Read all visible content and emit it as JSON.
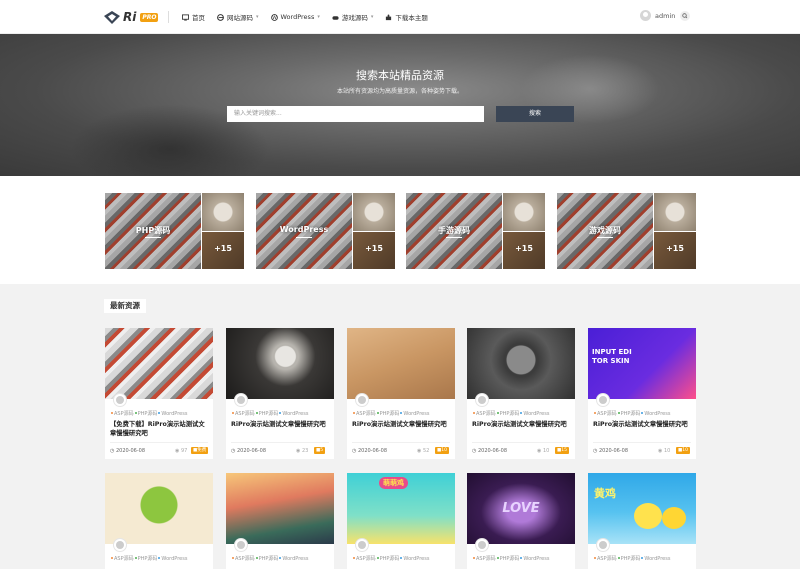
{
  "header": {
    "logo_text": "Ri",
    "logo_badge": "PRO",
    "nav": [
      {
        "label": "首页",
        "icon": "monitor-icon",
        "caret": false
      },
      {
        "label": "网站源码",
        "icon": "edge-icon",
        "caret": true
      },
      {
        "label": "WordPress",
        "icon": "wordpress-icon",
        "caret": true
      },
      {
        "label": "游戏源码",
        "icon": "gamepad-icon",
        "caret": true
      },
      {
        "label": "下载本主题",
        "icon": "puzzle-icon",
        "caret": false
      }
    ],
    "user": "admin"
  },
  "hero": {
    "title": "搜索本站精品资源",
    "subtitle": "本站所有资源均为高质量资源，各种姿势下载。",
    "search_placeholder": "输入关键词搜索...",
    "search_button": "搜索"
  },
  "categories": [
    {
      "label": "PHP源码",
      "count": "+15"
    },
    {
      "label": "WordPress",
      "count": "+15"
    },
    {
      "label": "手游源码",
      "count": "+15"
    },
    {
      "label": "游戏源码",
      "count": "+15"
    }
  ],
  "latest": {
    "title": "最新资源",
    "cards": [
      {
        "tags": [
          "ASP源码",
          "PHP源码",
          "WordPress"
        ],
        "title": "【免费下载】RiPro演示站测试文章慢慢研究吧",
        "date": "2020-06-08",
        "views": "97",
        "badge": "免费",
        "image": "cans"
      },
      {
        "tags": [
          "ASP源码",
          "PHP源码",
          "WordPress"
        ],
        "title": "RiPro演示站测试文章慢慢研究吧",
        "date": "2020-06-08",
        "views": "23",
        "badge": "5",
        "image": "logo-stamp"
      },
      {
        "tags": [
          "ASP源码",
          "PHP源码",
          "WordPress"
        ],
        "title": "RiPro演示站测试文章慢慢研究吧",
        "date": "2020-06-08",
        "views": "52",
        "badge": "10",
        "image": "wood-letters"
      },
      {
        "tags": [
          "ASP源码",
          "PHP源码",
          "WordPress"
        ],
        "title": "RiPro演示站测试文章慢慢研究吧",
        "date": "2020-06-08",
        "views": "10",
        "badge": "15",
        "image": "stone-logo"
      },
      {
        "tags": [
          "ASP源码",
          "PHP源码",
          "WordPress"
        ],
        "title": "RiPro演示站测试文章慢慢研究吧",
        "date": "2020-06-08",
        "views": "10",
        "badge": "10",
        "image": "purple-skin",
        "image_text": "INPUT EDI TOR SKIN"
      },
      {
        "tags": [
          "ASP源码",
          "PHP源码",
          "WordPress"
        ],
        "title": "",
        "date": "",
        "views": "",
        "badge": "",
        "image": "cartoon-fruit"
      },
      {
        "tags": [
          "ASP源码",
          "PHP源码",
          "WordPress"
        ],
        "title": "",
        "date": "",
        "views": "",
        "badge": "",
        "image": "lowpoly"
      },
      {
        "tags": [
          "ASP源码",
          "PHP源码",
          "WordPress"
        ],
        "title": "",
        "date": "",
        "views": "",
        "badge": "",
        "image": "chicks",
        "image_text": "萌萌鸡"
      },
      {
        "tags": [
          "ASP源码",
          "PHP源码",
          "WordPress"
        ],
        "title": "",
        "date": "",
        "views": "",
        "badge": "",
        "image": "love",
        "image_text": "LOVE"
      },
      {
        "tags": [
          "ASP源码",
          "PHP源码",
          "WordPress"
        ],
        "title": "",
        "date": "",
        "views": "",
        "badge": "",
        "image": "yellow-chick",
        "image_text": "黄鸡"
      }
    ]
  },
  "colors": {
    "accent": "#f2a011",
    "button": "#3a4555",
    "tag_asp": "#f0883a",
    "tag_php": "#4caf50",
    "tag_wp": "#3a9be0"
  }
}
